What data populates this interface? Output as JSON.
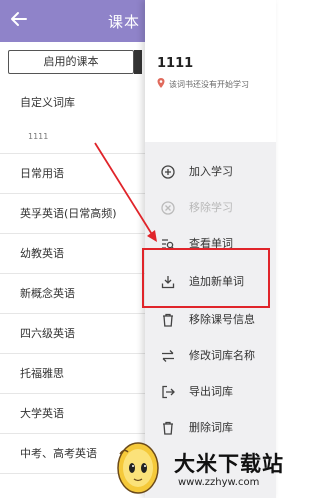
{
  "header": {
    "title": "课本"
  },
  "tabs": {
    "enabled_label": "启用的课本"
  },
  "libraries": {
    "custom": {
      "label": "自定义词库",
      "sub": "1111"
    },
    "items": [
      "日常用语",
      "英孚英语(日常高频)",
      "幼教英语",
      "新概念英语",
      "四六级英语",
      "托福雅思",
      "大学英语",
      "中考、高考英语"
    ]
  },
  "drawer": {
    "book_name": "1111",
    "status": "该词书还没有开始学习",
    "menu": [
      {
        "label": "加入学习",
        "icon": "plus-circle-icon",
        "enabled": true
      },
      {
        "label": "移除学习",
        "icon": "remove-circle-icon",
        "enabled": false
      },
      {
        "label": "查看单词",
        "icon": "search-list-icon",
        "enabled": true
      },
      {
        "label": "追加新单词",
        "icon": "download-icon",
        "enabled": true
      },
      {
        "label": "移除课号信息",
        "icon": "trash-icon",
        "enabled": true
      },
      {
        "label": "修改词库名称",
        "icon": "swap-icon",
        "enabled": true
      },
      {
        "label": "导出词库",
        "icon": "export-icon",
        "enabled": true
      },
      {
        "label": "删除词库",
        "icon": "trash-icon",
        "enabled": true
      }
    ]
  },
  "watermark": {
    "title": "大米下载站",
    "url": "www.zzhyw.com"
  },
  "colors": {
    "header": "#8f83c9",
    "highlight": "#e0242a",
    "menu_bg": "#f0f0f2"
  }
}
